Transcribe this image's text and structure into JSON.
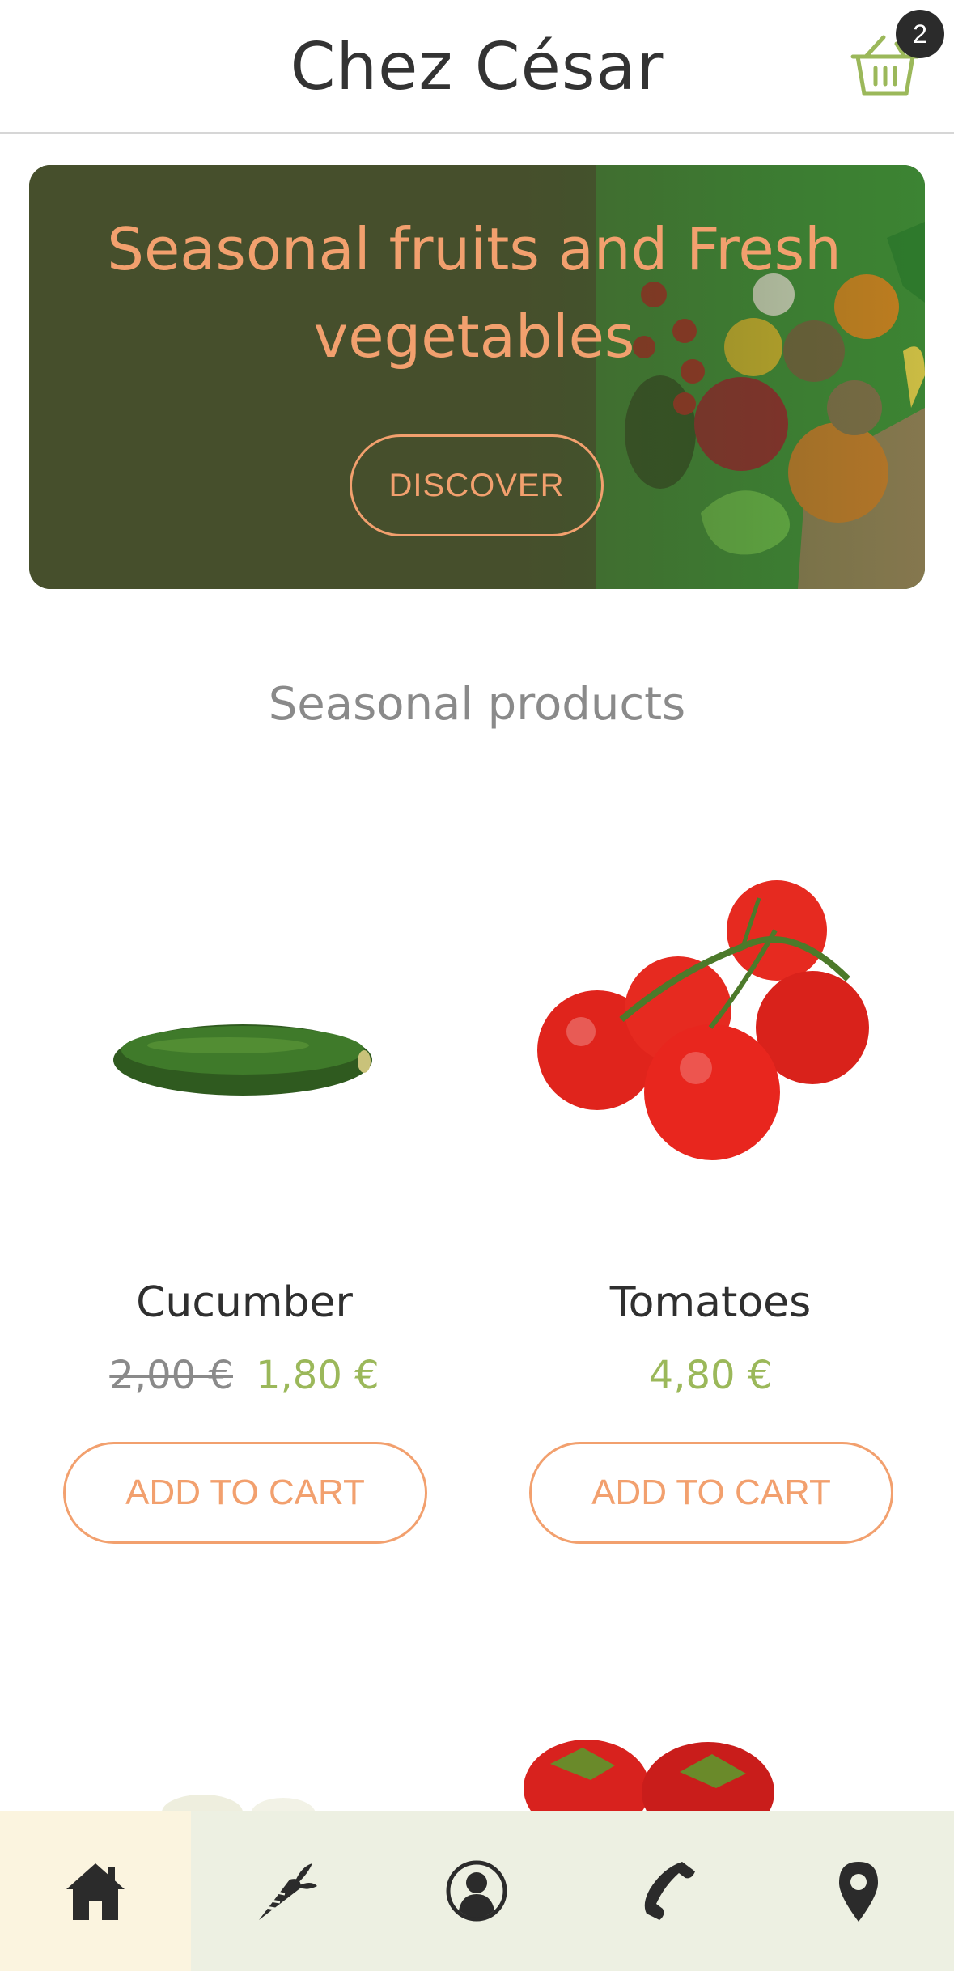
{
  "header": {
    "brand": "Chez César",
    "cart_count": "2",
    "cart_icon": "basket-icon"
  },
  "hero": {
    "title": "Seasonal fruits and Fresh vegetables",
    "button_label": "DISCOVER"
  },
  "section": {
    "title": "Seasonal products"
  },
  "products": [
    {
      "name": "Cucumber",
      "old_price": "2,00 €",
      "price": "1,80 €",
      "button_label": "ADD TO CART"
    },
    {
      "name": "Tomatoes",
      "old_price": "",
      "price": "4,80 €",
      "button_label": "ADD TO CART"
    }
  ],
  "bottom_nav": {
    "items": [
      {
        "icon": "home-icon",
        "active": true
      },
      {
        "icon": "carrot-icon",
        "active": false
      },
      {
        "icon": "user-icon",
        "active": false
      },
      {
        "icon": "phone-icon",
        "active": false
      },
      {
        "icon": "location-pin-icon",
        "active": false
      }
    ]
  },
  "colors": {
    "accent_orange": "#f2a06e",
    "hero_bg": "#464f2c",
    "price_green": "#9bb85a",
    "nav_bg": "#edf0e2",
    "nav_active_bg": "#fbf4df"
  }
}
